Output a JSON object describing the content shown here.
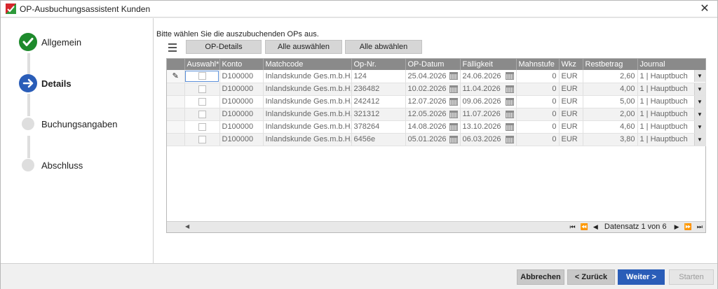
{
  "window": {
    "title": "OP-Ausbuchungsassistent Kunden",
    "close_symbol": "✕"
  },
  "wizard": {
    "steps": [
      {
        "label": "Allgemein",
        "state": "done"
      },
      {
        "label": "Details",
        "state": "active"
      },
      {
        "label": "Buchungsangaben",
        "state": "pending"
      },
      {
        "label": "Abschluss",
        "state": "pending"
      }
    ]
  },
  "main": {
    "instruction": "Bitte wählen Sie die auszubuchenden OPs aus."
  },
  "toolbar": {
    "op_details": "OP-Details",
    "select_all": "Alle auswählen",
    "deselect_all": "Alle abwählen"
  },
  "grid": {
    "columns": [
      "Auswahl*",
      "Konto",
      "Matchcode",
      "Op-Nr.",
      "OP-Datum",
      "Fälligkeit",
      "Mahnstufe",
      "Wkz",
      "Restbetrag",
      "Journal"
    ],
    "rows": [
      {
        "konto": "D100000",
        "matchcode": "Inlandskunde Ges.m.b.H, G...",
        "opnr": "124",
        "opdatum": "25.04.2026",
        "faelligkeit": "24.06.2026",
        "mahnstufe": "0",
        "wkz": "EUR",
        "restbetrag": "2,60",
        "journal": "1  |  Hauptbuch"
      },
      {
        "konto": "D100000",
        "matchcode": "Inlandskunde Ges.m.b.H, G...",
        "opnr": "236482",
        "opdatum": "10.02.2026",
        "faelligkeit": "11.04.2026",
        "mahnstufe": "0",
        "wkz": "EUR",
        "restbetrag": "4,00",
        "journal": "1  |  Hauptbuch"
      },
      {
        "konto": "D100000",
        "matchcode": "Inlandskunde Ges.m.b.H, G...",
        "opnr": "242412",
        "opdatum": "12.07.2026",
        "faelligkeit": "09.06.2026",
        "mahnstufe": "0",
        "wkz": "EUR",
        "restbetrag": "5,00",
        "journal": "1  |  Hauptbuch"
      },
      {
        "konto": "D100000",
        "matchcode": "Inlandskunde Ges.m.b.H, G...",
        "opnr": "321312",
        "opdatum": "12.05.2026",
        "faelligkeit": "11.07.2026",
        "mahnstufe": "0",
        "wkz": "EUR",
        "restbetrag": "2,00",
        "journal": "1  |  Hauptbuch"
      },
      {
        "konto": "D100000",
        "matchcode": "Inlandskunde Ges.m.b.H, G...",
        "opnr": "378264",
        "opdatum": "14.08.2026",
        "faelligkeit": "13.10.2026",
        "mahnstufe": "0",
        "wkz": "EUR",
        "restbetrag": "4,60",
        "journal": "1  |  Hauptbuch"
      },
      {
        "konto": "D100000",
        "matchcode": "Inlandskunde Ges.m.b.H, G...",
        "opnr": "6456e",
        "opdatum": "05.01.2026",
        "faelligkeit": "06.03.2026",
        "mahnstufe": "0",
        "wkz": "EUR",
        "restbetrag": "3,80",
        "journal": "1  |  Hauptbuch"
      }
    ],
    "pager_text": "Datensatz 1 von 6"
  },
  "footer": {
    "cancel": "Abbrechen",
    "back": "< Zurück",
    "next": "Weiter >",
    "start": "Starten"
  },
  "colors": {
    "accent": "#2a5db8",
    "done": "#1e8a2c",
    "header": "#8a8a8a"
  }
}
